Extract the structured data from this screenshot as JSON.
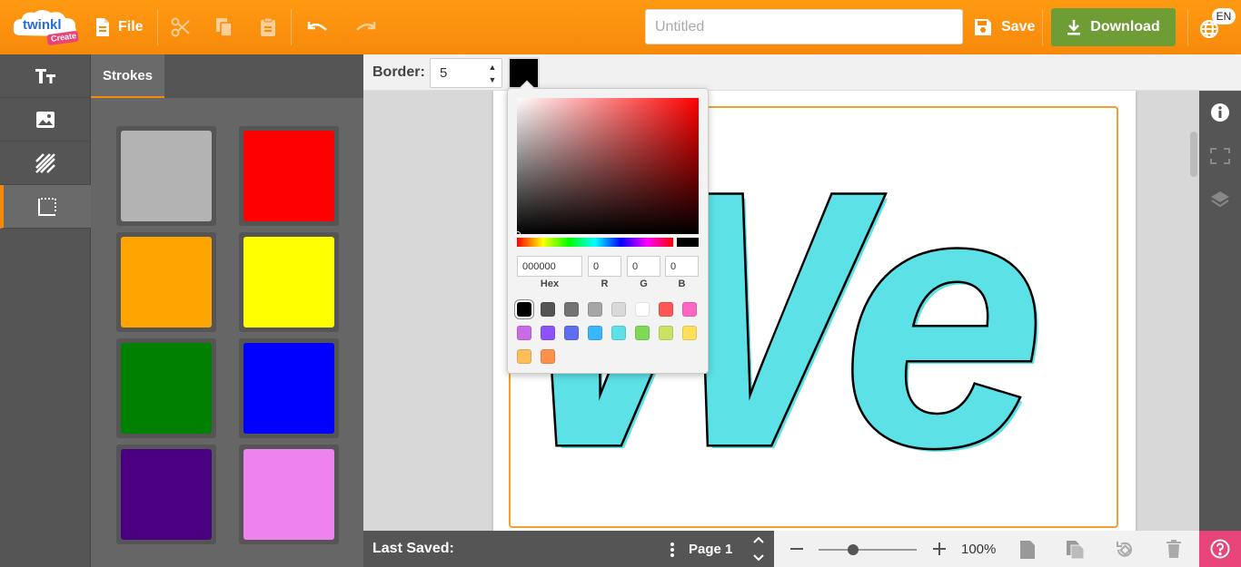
{
  "topbar": {
    "logo_text": "twinkl",
    "logo_sub": "Create",
    "file_label": "File",
    "title_placeholder": "Untitled",
    "save_label": "Save",
    "download_label": "Download",
    "language": "EN"
  },
  "leftnav": {
    "items": [
      "text-tool",
      "image-tool",
      "pattern-tool",
      "border-tool"
    ],
    "active_index": 3
  },
  "panel": {
    "tab_label": "Strokes",
    "swatches": [
      "#b3b3b3",
      "#ff0000",
      "#ffa500",
      "#ffff00",
      "#008000",
      "#0000ff",
      "#4b0082",
      "#ee82ee"
    ]
  },
  "borderbar": {
    "label": "Border:",
    "value": "5",
    "color": "#000000"
  },
  "canvas": {
    "text": "We",
    "fill": "#5ce1e6",
    "stroke": "#000000",
    "border_color": "#f0a030"
  },
  "picker": {
    "hex_value": "000000",
    "r_value": "0",
    "g_value": "0",
    "b_value": "0",
    "hex_label": "Hex",
    "r_label": "R",
    "g_label": "G",
    "b_label": "B",
    "palette": [
      "#000000",
      "#545454",
      "#737373",
      "#a6a6a6",
      "#d9d9d9",
      "#ffffff",
      "#ff5757",
      "#ff66c4",
      "#cb6ce6",
      "#8c52ff",
      "#5e6ef0",
      "#38b6ff",
      "#5ce1e6",
      "#7ed957",
      "#c9e265",
      "#ffde59",
      "#ffbd59",
      "#ff914d"
    ]
  },
  "footer": {
    "last_saved_label": "Last Saved:",
    "page_label": "Page 1",
    "zoom": "100%",
    "zoom_fraction": 0.35
  }
}
